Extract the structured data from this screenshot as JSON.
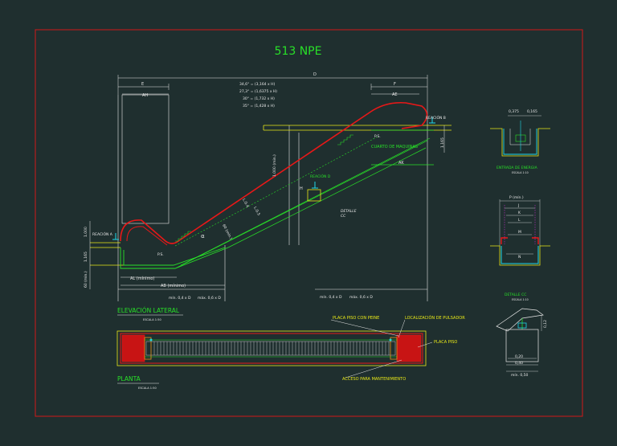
{
  "title": "513 NPE",
  "colors": {
    "background": "#1f2f2f",
    "frame": "#d01818",
    "red": "#e81818",
    "green": "#28e028",
    "yellow": "#e8e818",
    "white": "#e8e8e8",
    "cyan": "#20d8e8",
    "magenta": "#e828e8",
    "orange": "#e89818"
  },
  "elevation": {
    "top_dims": {
      "D": "D",
      "E": "E",
      "F": "F",
      "AH": "AH",
      "AE": "AE",
      "formula_1": "34,6° = (3,164 x H)",
      "formula_2": "27,3° = (1,6375 x H)",
      "formula_3": "30° = (1,732 x H)",
      "formula_4": "35° = (1,428 x H)"
    },
    "labels": {
      "reaction_b": "REACIÓN B",
      "reaction_a": "REACIÓN A",
      "reaction_d": "REACIÓN D",
      "ps_top": "P.S.",
      "ps_bottom": "P.S.",
      "machine_room": "CUARTO DE MAQUINAS",
      "ak": "AK",
      "h": "H",
      "alpha": "α",
      "detalle": "DETALLE",
      "detalle_sub": "CC",
      "dim_1000_left": "1.000",
      "dim_1165_left": "1.165",
      "dim_60_left": "60 (min.)",
      "dim_1165_right": "1.165",
      "dim_1000_diag": "1.000 (min.)",
      "diag_1": "L.G.4",
      "diag_2": "L.G.5",
      "diag_3": "60 (min.)",
      "al_min": "AL (mínimo)",
      "ab_min": "AB (mínimo)",
      "min_04d_l": "mín. 0,4 x D",
      "max_06d_l": "máx. 0,6 x D",
      "min_04d_r": "mín. 0,4 x D",
      "max_06d_r": "máx. 0,6 x D"
    },
    "caption": "ELEVACIÓN LATERAL",
    "scale": "ESCALA 1:50"
  },
  "plan": {
    "caption": "PLANTA",
    "scale": "ESCALA 1:50",
    "labels": {
      "plate_comb": "PLACA PISO CON PEINE",
      "button": "LOCALIZACIÓN DE PULSADOR",
      "plate": "PLACA PISO",
      "access": "ACCESO PARA MANTENIMIENTO"
    }
  },
  "detail_top": {
    "dim_a": "0,375",
    "dim_b": "0,165",
    "caption": "ENTRADA DE ENERGIA",
    "scale": "ESCALA 1:10"
  },
  "detail_mid": {
    "p_min": "P (mín.)",
    "j": "J",
    "k": "K",
    "l": "L",
    "m": "M",
    "n": "N"
  },
  "detail_cc": {
    "caption": "DETALLE CC",
    "scale": "ESCALA 1:10",
    "dim_side": "0,12",
    "dim_20": "0,20",
    "dim_40": "0,40",
    "dim_50": "mín. 0,50"
  }
}
